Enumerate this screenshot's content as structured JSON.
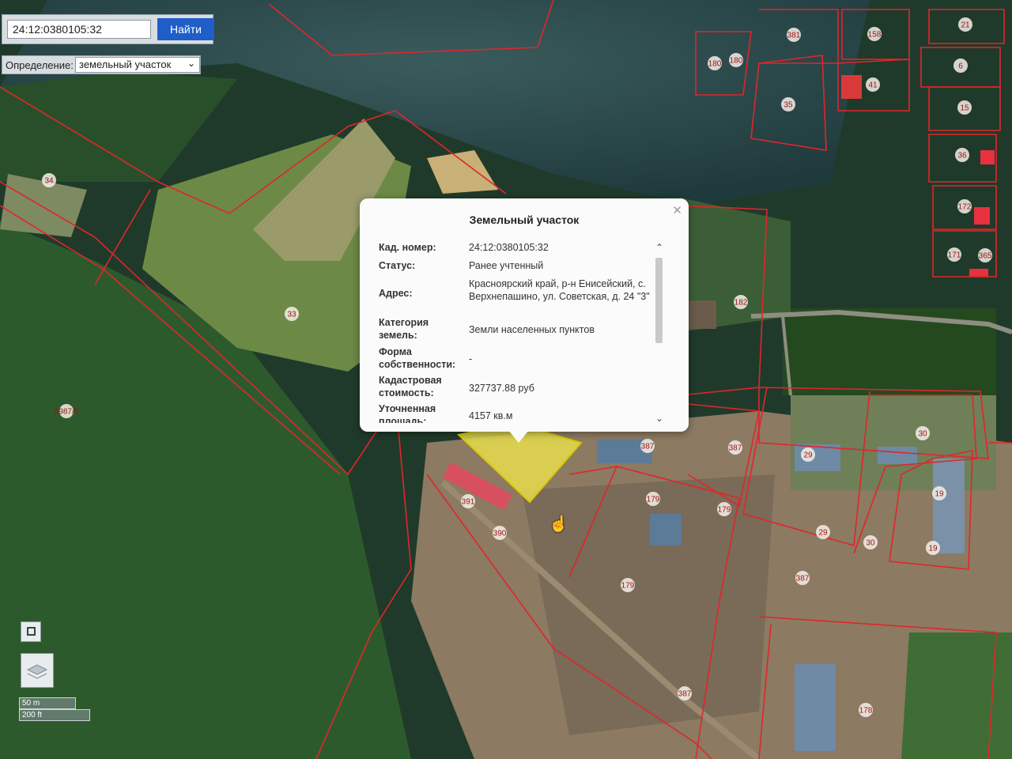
{
  "search": {
    "value": "24:12:0380105:32",
    "button_label": "Найти"
  },
  "definition": {
    "label": "Определение:",
    "selected": "земельный участок"
  },
  "popup": {
    "title": "Земельный участок",
    "rows": [
      {
        "label": "Кад. номер:",
        "value": "24:12:0380105:32"
      },
      {
        "label": "Статус:",
        "value": "Ранее учтенный"
      },
      {
        "label": "Адрес:",
        "value": "Красноярский край, р-н Енисейский, с. Верхнепашино, ул. Советская, д. 24 \"3\""
      },
      {
        "label": "Категория земель:",
        "value": "Земли населенных пунктов"
      },
      {
        "label": "Форма собственности:",
        "value": "-"
      },
      {
        "label": "Кадастровая стоимость:",
        "value": "327737.88 руб"
      },
      {
        "label": "Уточненная площадь:",
        "value": "4157 кв.м"
      }
    ]
  },
  "map_labels": [
    "34",
    "33",
    "5987/3",
    "381",
    "158",
    "21",
    "6",
    "41",
    "180",
    "180",
    "35",
    "15",
    "36",
    "172",
    "171",
    "365",
    "182",
    "387",
    "387",
    "29",
    "30",
    "29",
    "30",
    "19",
    "19",
    "179",
    "179",
    "179",
    "391",
    "390",
    "387",
    "387",
    "178"
  ],
  "scale": {
    "metric": "50 m",
    "imperial": "200 ft"
  },
  "colors": {
    "parcel_line": "#e0262b",
    "selected_parcel": "#f0e64a",
    "search_button": "#1f5ec9",
    "forest": "#2d5a2c"
  },
  "icons": {
    "map_mode": "square-icon",
    "layers": "layers-icon",
    "close": "close-icon",
    "scroll_up": "chevron-up-icon",
    "scroll_down": "chevron-down-icon",
    "cursor": "hand-pointer-icon"
  }
}
